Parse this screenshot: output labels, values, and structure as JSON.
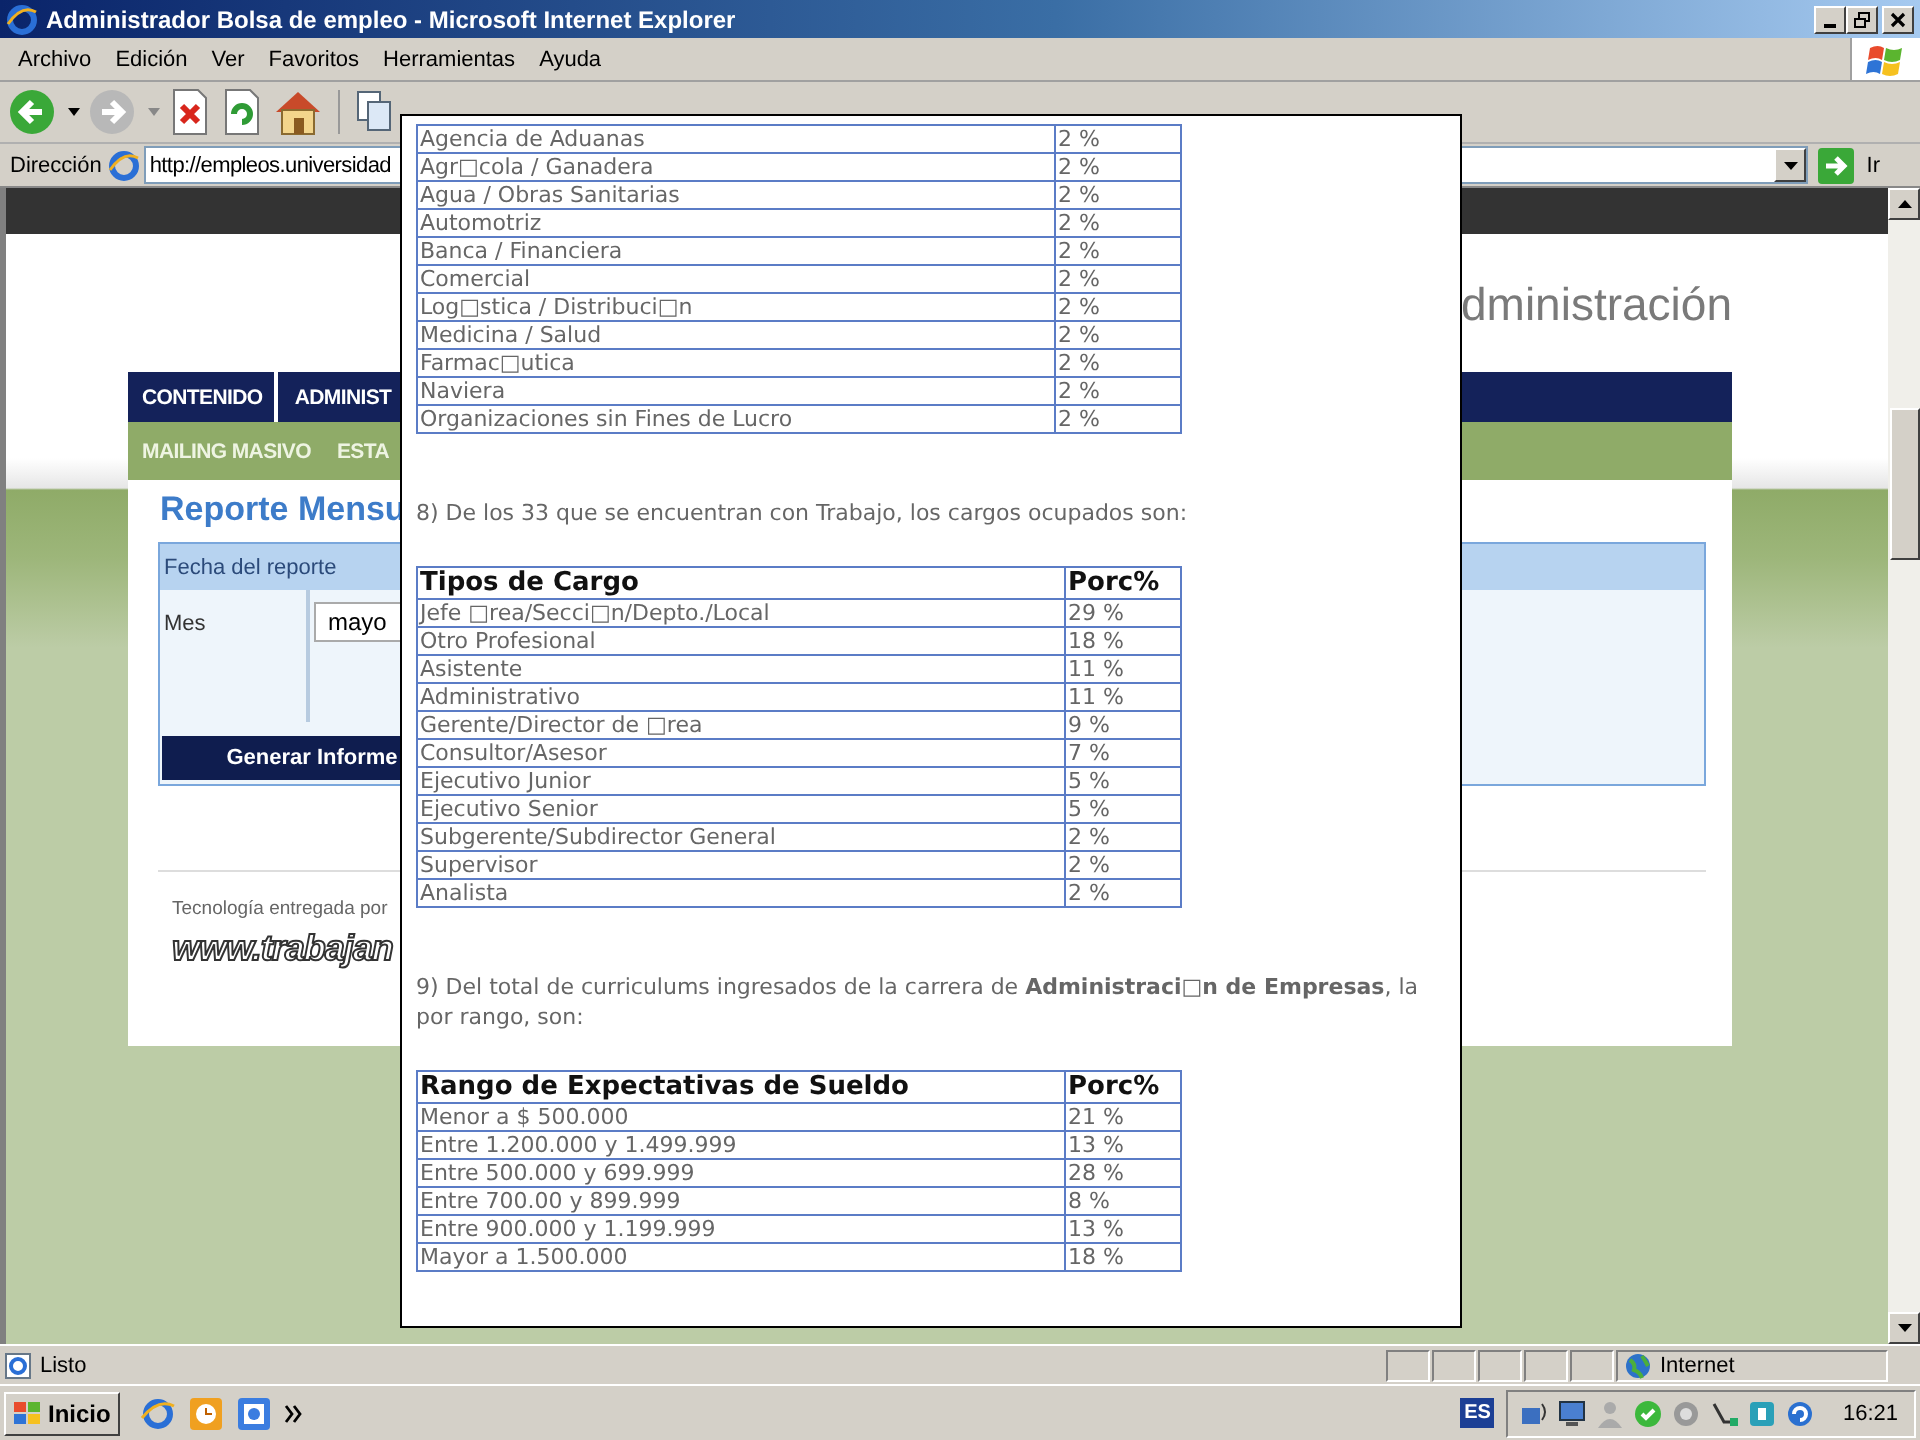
{
  "window": {
    "title": "Administrador Bolsa de empleo - Microsoft Internet Explorer"
  },
  "menu": [
    "Archivo",
    "Edición",
    "Ver",
    "Favoritos",
    "Herramientas",
    "Ayuda"
  ],
  "address_bar": {
    "label": "Dirección",
    "value": "http://empleos.universidad",
    "go_label": "Ir"
  },
  "page": {
    "header_title": "dministración",
    "nav": [
      "CONTENIDO",
      "ADMINIST"
    ],
    "subnav": [
      "MAILING MASIVO",
      "ESTA"
    ],
    "heading": "Reporte Mensu",
    "form": {
      "title": "Fecha del reporte",
      "month_label": "Mes",
      "month_value": "mayo",
      "button": "Generar Informe"
    },
    "footer_text": "Tecnología entregada por",
    "footer_logo": "www.trabajan"
  },
  "report": {
    "table_1": {
      "rows": [
        [
          "Agencia de Aduanas",
          "2 %"
        ],
        [
          "Agr□cola / Ganadera",
          "2 %"
        ],
        [
          "Agua / Obras Sanitarias",
          "2 %"
        ],
        [
          "Automotriz",
          "2 %"
        ],
        [
          "Banca / Financiera",
          "2 %"
        ],
        [
          "Comercial",
          "2 %"
        ],
        [
          "Log□stica / Distribuci□n",
          "2 %"
        ],
        [
          "Medicina / Salud",
          "2 %"
        ],
        [
          "Farmac□utica",
          "2 %"
        ],
        [
          "Naviera",
          "2 %"
        ],
        [
          "Organizaciones sin Fines de Lucro",
          "2 %"
        ]
      ]
    },
    "question_8": [
      "8) De los 33 que se encuentran con Trabajo, los cargos ocupados son:"
    ],
    "table_2": {
      "columns": [
        "Tipos de Cargo",
        "Porc%"
      ],
      "rows": [
        [
          "Jefe □rea/Secci□n/Depto./Local",
          "29 %"
        ],
        [
          "Otro Profesional",
          "18 %"
        ],
        [
          "Asistente",
          "11 %"
        ],
        [
          "Administrativo",
          "11 %"
        ],
        [
          "Gerente/Director de □rea",
          "9 %"
        ],
        [
          "Consultor/Asesor",
          "7 %"
        ],
        [
          "Ejecutivo Junior",
          "5 %"
        ],
        [
          "Ejecutivo Senior",
          "5 %"
        ],
        [
          "Subgerente/Subdirector General",
          "2 %"
        ],
        [
          "Supervisor",
          "2 %"
        ],
        [
          "Analista",
          "2 %"
        ]
      ]
    },
    "question_9": [
      "9) Del total de curriculums ingresados de la carrera de **Administraci□n de Empresas**, la",
      "por rango, son:"
    ],
    "table_3": {
      "columns": [
        "Rango de Expectativas de Sueldo",
        "Porc%"
      ],
      "rows": [
        [
          "Menor a $ 500.000",
          "21 %"
        ],
        [
          "Entre 1.200.000 y 1.499.999",
          "13 %"
        ],
        [
          "Entre 500.000 y 699.999",
          "28 %"
        ],
        [
          "Entre 700.00 y 899.999",
          "8 %"
        ],
        [
          "Entre 900.000 y 1.199.999",
          "13 %"
        ],
        [
          "Mayor a 1.500.000",
          "18 %"
        ]
      ]
    }
  },
  "status_bar": {
    "text": "Listo",
    "zone": "Internet"
  },
  "taskbar": {
    "start": "Inicio",
    "language": "ES",
    "clock": "16:21"
  }
}
